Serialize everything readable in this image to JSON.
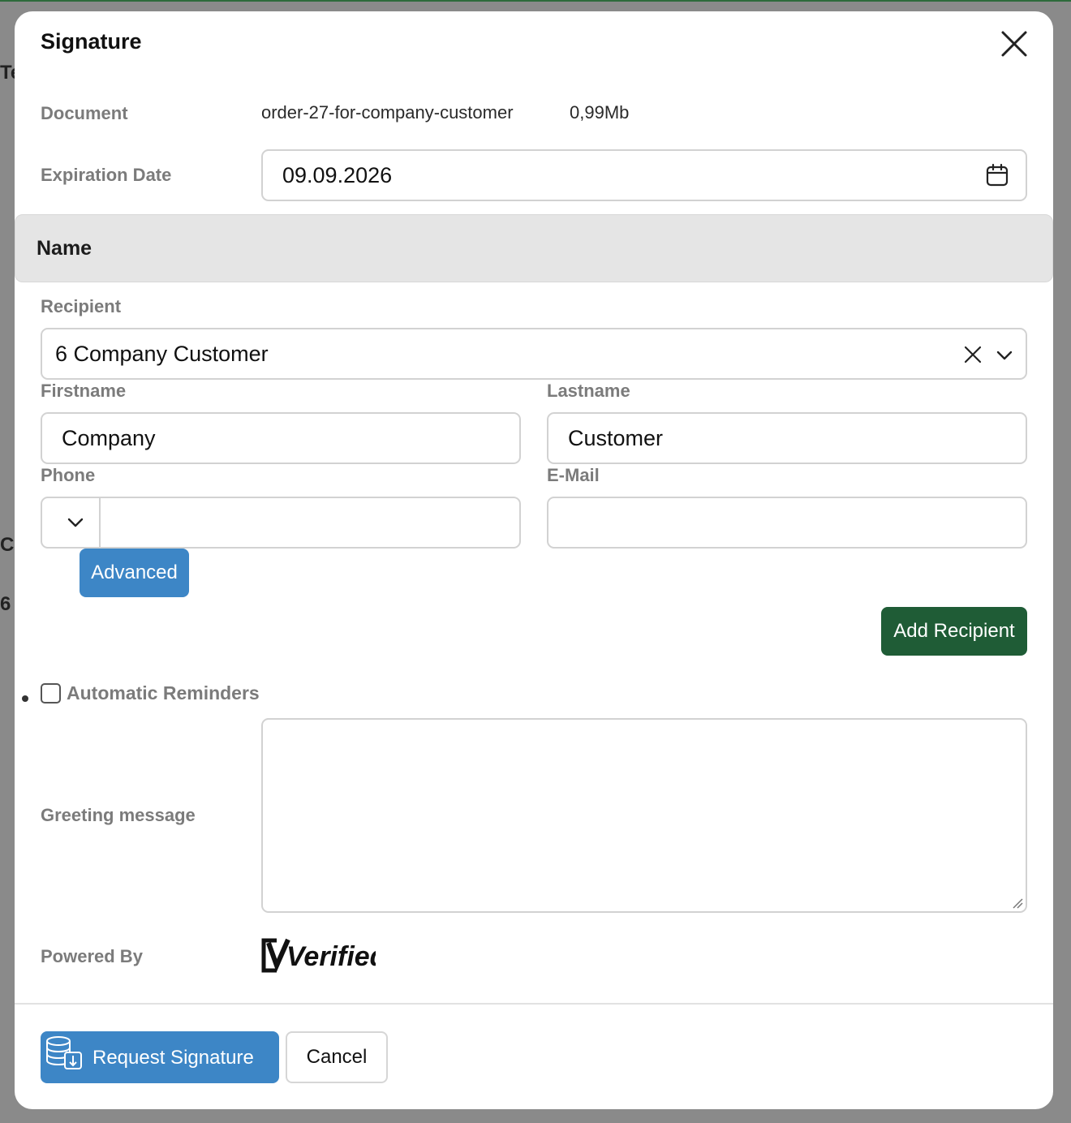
{
  "background": {
    "fragments": [
      "Te",
      "C",
      "6"
    ]
  },
  "dialog": {
    "title": "Signature",
    "document_label": "Document",
    "document_name": "order-27-for-company-customer",
    "document_size": "0,99Mb",
    "expiration_label": "Expiration Date",
    "expiration_value": "09.09.2026",
    "section_title": "Name",
    "recipient_label": "Recipient",
    "recipient_value": "6 Company Customer",
    "firstname_label": "Firstname",
    "firstname_value": "Company",
    "lastname_label": "Lastname",
    "lastname_value": "Customer",
    "phone_label": "Phone",
    "phone_value": "",
    "email_label": "E-Mail",
    "email_value": "",
    "advanced_button": "Advanced",
    "add_recipient_button": "Add Recipient",
    "reminders_label": "Automatic Reminders",
    "reminders_checked": false,
    "greeting_label": "Greeting message",
    "greeting_value": "",
    "powered_by_label": "Powered By",
    "provider_logo_text": "Verified",
    "request_button": "Request Signature",
    "cancel_button": "Cancel"
  },
  "colors": {
    "primary_blue": "#3d86c6",
    "success_green": "#1f5c36",
    "section_band": "#e5e5e5",
    "label_gray": "#7b7b7b"
  },
  "icons": {
    "close": "close-icon",
    "calendar": "calendar-icon",
    "clear": "clear-icon",
    "chevron": "chevron-down-icon",
    "request": "database-sign-icon"
  }
}
